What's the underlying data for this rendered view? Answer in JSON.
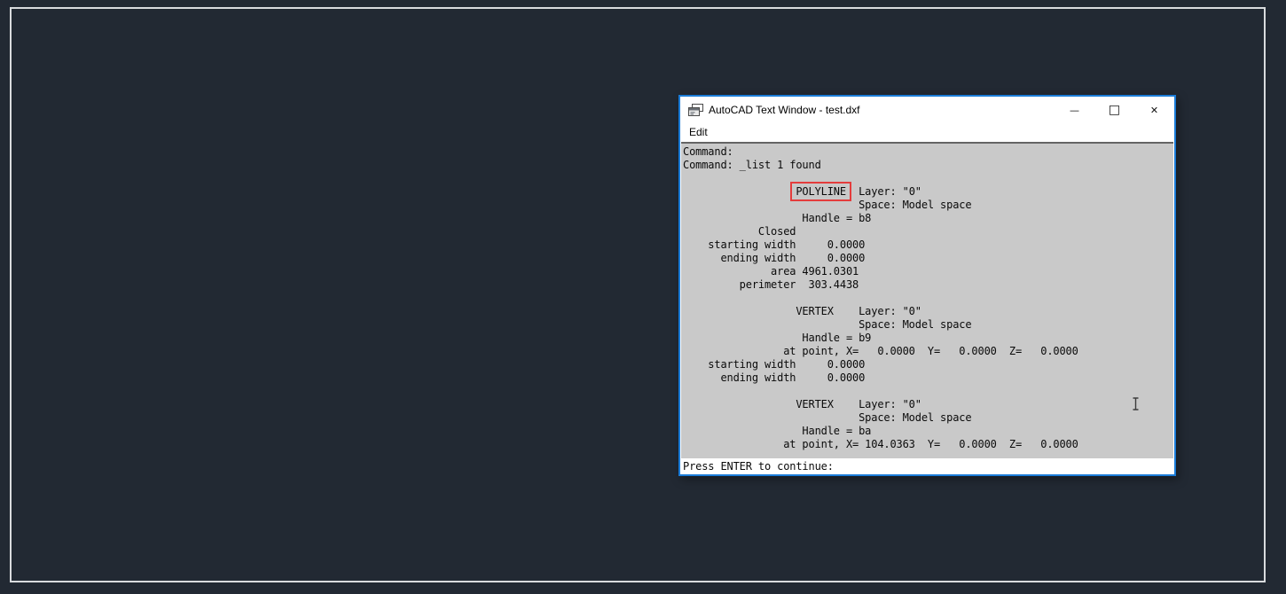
{
  "desktop": {
    "background_color": "#222933",
    "frame_border_color": "#d9dbde"
  },
  "window": {
    "title": "AutoCAD Text Window - test.dxf",
    "accent_border_color": "#1b7cd8",
    "controls": {
      "minimize": "—",
      "maximize": "□",
      "close": "✕"
    },
    "menu": [
      {
        "label": "Edit"
      }
    ],
    "console": {
      "background_color": "#c9c9c9",
      "lines": [
        "Command:",
        "Command: _list 1 found",
        "",
        "                  POLYLINE  Layer: \"0\"",
        "                            Space: Model space",
        "                   Handle = b8",
        "            Closed",
        "    starting width     0.0000",
        "      ending width     0.0000",
        "              area 4961.0301",
        "         perimeter  303.4438",
        "",
        "                  VERTEX    Layer: \"0\"",
        "                            Space: Model space",
        "                   Handle = b9",
        "                at point, X=   0.0000  Y=   0.0000  Z=   0.0000",
        "    starting width     0.0000",
        "      ending width     0.0000",
        "",
        "                  VERTEX    Layer: \"0\"",
        "                            Space: Model space",
        "                   Handle = ba",
        "                at point, X= 104.0363  Y=   0.0000  Z=   0.0000"
      ],
      "highlight": {
        "line_index": 3,
        "text": "POLYLINE",
        "border_color": "#e43c3c"
      }
    },
    "input_line": "Press ENTER to continue:"
  },
  "icons": {
    "app": "text-window-icon",
    "pointer": "i-beam-text-cursor"
  }
}
